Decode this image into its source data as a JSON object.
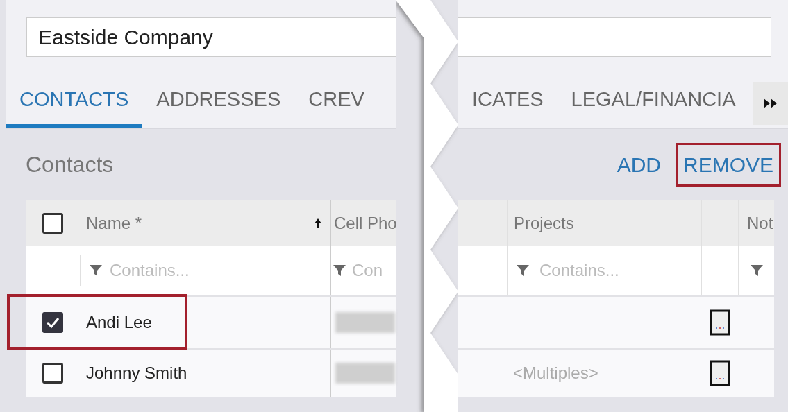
{
  "company_field": {
    "value": "Eastside Company"
  },
  "tabs": [
    {
      "label": "CONTACTS",
      "selected": true
    },
    {
      "label": "ADDRESSES",
      "selected": false
    },
    {
      "label": "CREV",
      "selected": false
    },
    {
      "label": "ICATES",
      "selected": false
    },
    {
      "label": "LEGAL/FINANCIA",
      "selected": false
    }
  ],
  "section": {
    "title": "Contacts",
    "actions": [
      {
        "label": "ADD",
        "highlighted": false
      },
      {
        "label": "REMOVE",
        "highlighted": true
      }
    ]
  },
  "table": {
    "select_all": {
      "checked": false
    },
    "columns": [
      {
        "label": "Name *",
        "filter_placeholder": "Contains..."
      },
      {
        "label": "Cell Pho",
        "filter_placeholder": "Con"
      },
      {
        "label": "Projects",
        "filter_placeholder": "Contains..."
      },
      {
        "label": "Not"
      }
    ],
    "rows": [
      {
        "name": "Andi Lee",
        "selected": true,
        "highlighted": true
      },
      {
        "name": "Johnny Smith",
        "selected": false,
        "highlighted": false,
        "projects": "<Multiples>"
      }
    ]
  }
}
